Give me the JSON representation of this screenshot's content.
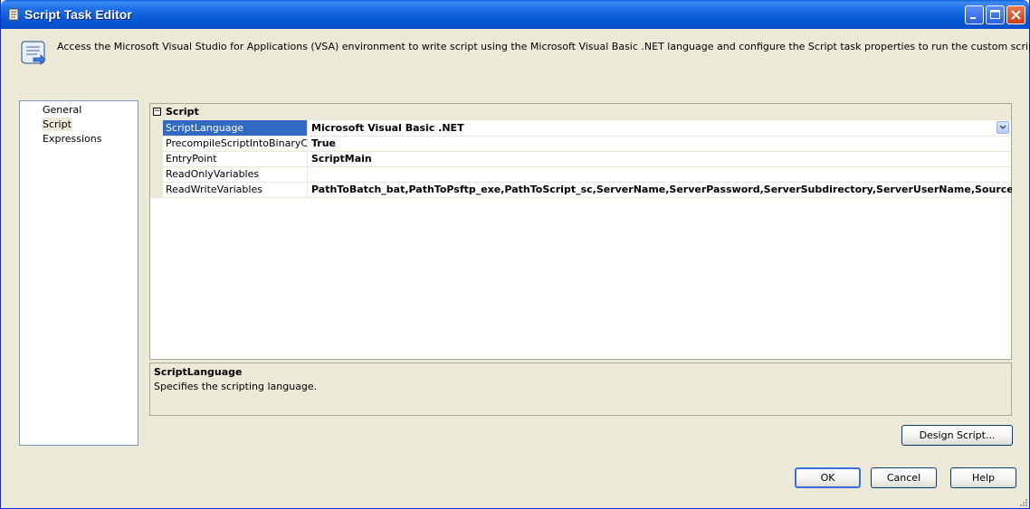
{
  "window": {
    "title": "Script Task Editor"
  },
  "banner": {
    "description": "Access the Microsoft Visual Studio for Applications (VSA) environment to write script using the Microsoft Visual Basic .NET language and configure the Script task properties to run the custom script."
  },
  "nav": {
    "items": [
      {
        "label": "General"
      },
      {
        "label": "Script"
      },
      {
        "label": "Expressions"
      }
    ],
    "selected": "Script"
  },
  "grid": {
    "category": "Script",
    "properties": [
      {
        "name": "ScriptLanguage",
        "value": "Microsoft Visual Basic .NET"
      },
      {
        "name": "PrecompileScriptIntoBinaryCode",
        "value": "True"
      },
      {
        "name": "EntryPoint",
        "value": "ScriptMain"
      },
      {
        "name": "ReadOnlyVariables",
        "value": ""
      },
      {
        "name": "ReadWriteVariables",
        "value": "PathToBatch_bat,PathToPsftp_exe,PathToScript_sc,ServerName,ServerPassword,ServerSubdirectory,ServerUserName,SourceFilePath"
      }
    ]
  },
  "help_pane": {
    "title": "ScriptLanguage",
    "description": "Specifies the scripting language."
  },
  "buttons": {
    "design_script": "Design Script...",
    "ok": "OK",
    "cancel": "Cancel",
    "help": "Help"
  },
  "colors": {
    "titlebar": "#0a5fd8",
    "selection": "#316ac5",
    "window_bg": "#ece9d8"
  },
  "icons": {
    "title": "script-icon",
    "banner": "scroll-icon"
  }
}
